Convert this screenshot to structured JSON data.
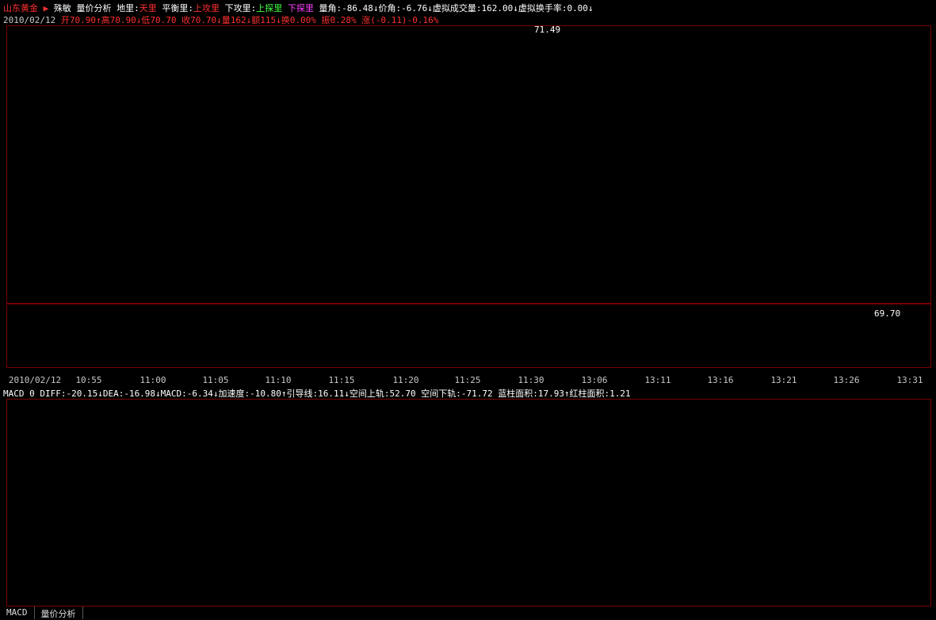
{
  "header": {
    "stock": "山东黄金",
    "arrow": "▶",
    "items": [
      "殊敏",
      "量价分析",
      "地里:",
      "天里",
      "平衡里:",
      "上攻里",
      "下攻里:",
      "上探里",
      "下探里"
    ],
    "readouts": "量角:-86.48↓价角:-6.76↓虚拟成交量:162.00↓虚拟换手率:0.00↓"
  },
  "quote": {
    "date": "2010/02/12",
    "text": "开70.90↑高70.90↓低70.70 收70.70↓量162↓额115↓换0.00% 振0.28% 涨(-0.11)-0.16%"
  },
  "price_labels": {
    "high": "71.49",
    "low": "69.70"
  },
  "time_axis": [
    "2010/02/12",
    "10:55",
    "11:00",
    "11:05",
    "11:10",
    "11:15",
    "11:20",
    "11:25",
    "11:30",
    "13:06",
    "13:11",
    "13:16",
    "13:21",
    "13:26",
    "13:31"
  ],
  "macd_header": "MACD 0 DIFF:-20.15↓DEA:-16.98↓MACD:-6.34↓加速度:-10.80↑引导线:16.11↓空间上轨:52.70 空间下轨:-71.72 蓝柱面积:17.93↑红柱面积:1.21",
  "tabs": [
    "MACD",
    "量价分析"
  ]
}
